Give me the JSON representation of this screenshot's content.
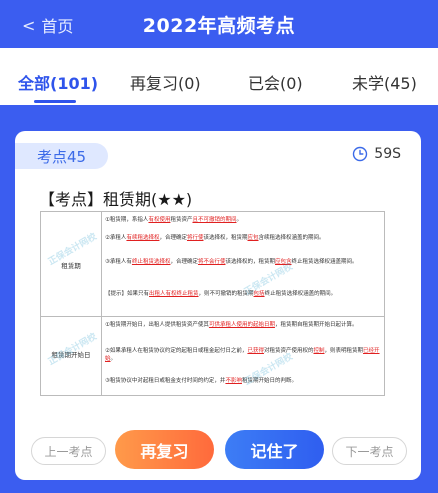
{
  "header": {
    "back_label": "首页",
    "back_icon": "chevron-left-icon",
    "title": "2022年高频考点"
  },
  "tabs": [
    {
      "label": "全部(101)",
      "active": true
    },
    {
      "label": "再复习(0)",
      "active": false
    },
    {
      "label": "已会(0)",
      "active": false
    },
    {
      "label": "未学(45)",
      "active": false
    }
  ],
  "card": {
    "badge": "考点45",
    "timer": "59S",
    "title": "【考点】租赁期(★★)",
    "doc": {
      "row1_label": "租赁期",
      "row2_label": "租赁期开始日",
      "row1_lines": [
        [
          "①租赁期，系指人",
          "有权使用",
          "租赁资产",
          "且不可撤销的期间",
          "。"
        ],
        [
          "②承租人",
          "有续租选择权",
          "，合理确定",
          "将行使",
          "该选择权，租赁期",
          "应包",
          "含续租选择权涵盖的期间。"
        ],
        [
          "③承租人有",
          "终止租赁选择权",
          "，合理确定",
          "将不会行使",
          "该选择权的，租赁期",
          "应包含",
          "终止租赁选择权涵盖期间。"
        ],
        [
          "【提示】如果只有",
          "出租人有权终止租赁",
          "，则不可撤销的租赁期",
          "包括",
          "终止租赁选择权涵盖的期间。"
        ]
      ],
      "row2_lines": [
        [
          "①租赁期开始日，出租人提供租赁资产使其",
          "可供承租人使用的起始日期",
          "，租赁期自租赁期开始日起计算。"
        ],
        [
          "②如果承租人在租赁协议约定的起租日或租金起付日之前，",
          "已获得",
          "对租赁资产使用权的",
          "控制",
          "，则表明租赁期",
          "已经开始",
          "。"
        ],
        [
          "③租赁协议中对起租日或租金支付时间的约定，并",
          "不影响",
          "租赁期开始日的判断。"
        ]
      ],
      "watermark": "正保会计网校"
    }
  },
  "actions": {
    "prev_label": "上一考点",
    "review_label": "再复习",
    "remember_label": "记住了",
    "next_label": "下一考点"
  },
  "colors": {
    "primary": "#3b5df0",
    "review": "#ff7a3c",
    "remember": "#3d6af5",
    "badge_bg": "#dfe8ff"
  }
}
